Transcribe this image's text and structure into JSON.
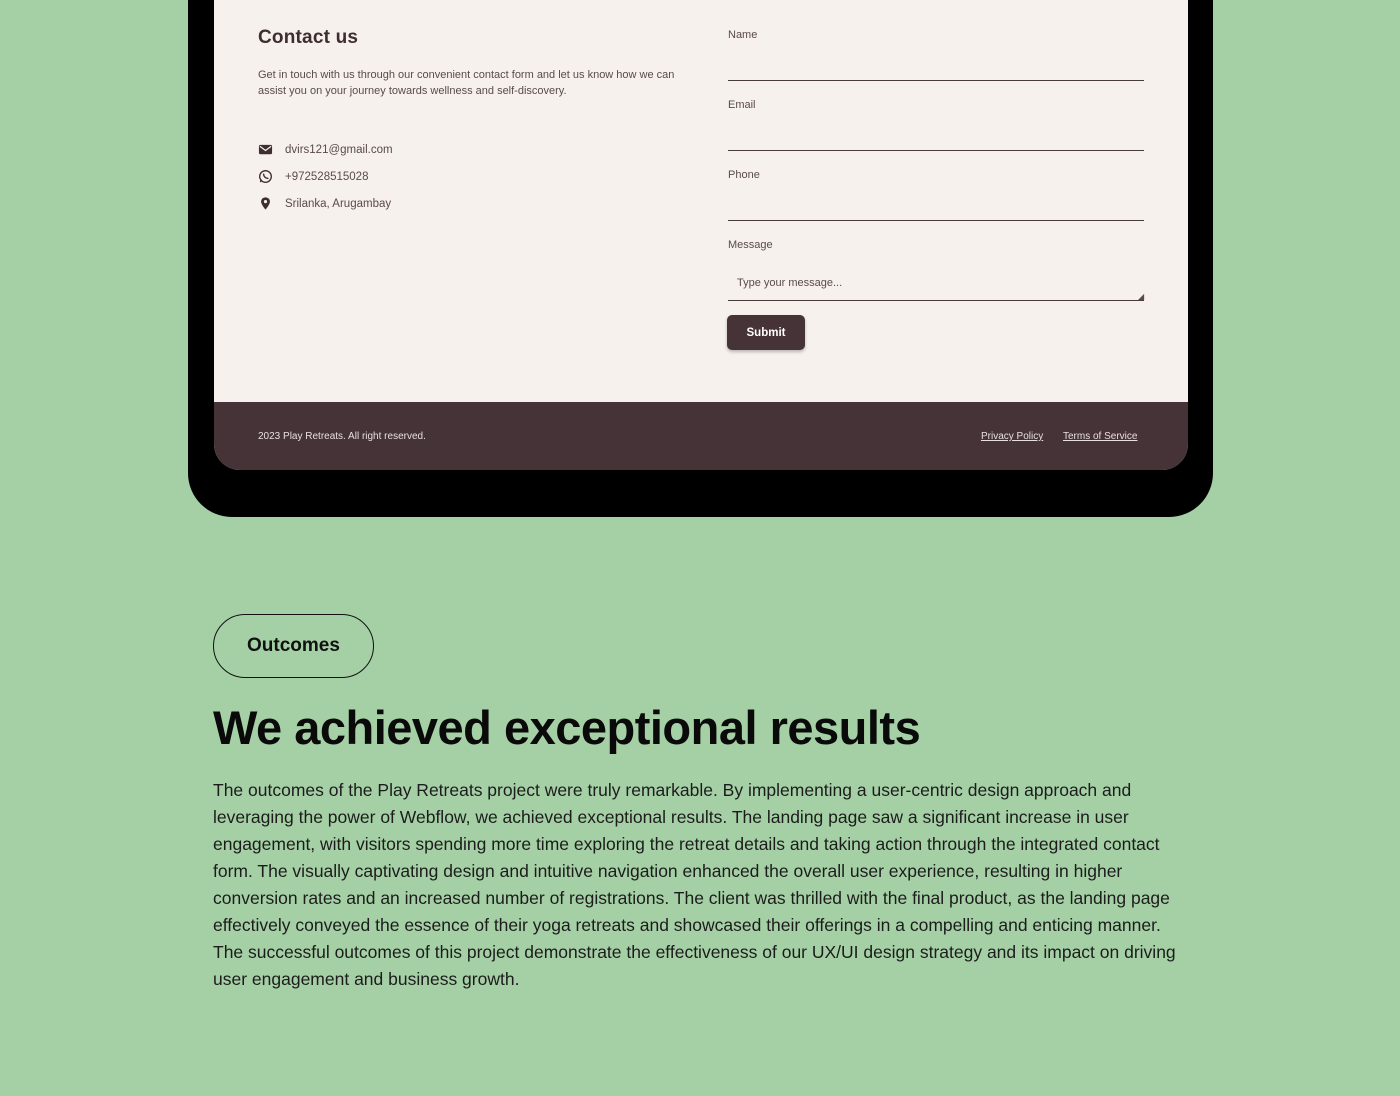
{
  "contact": {
    "title": "Contact us",
    "description": "Get in touch with us through our convenient contact form and let us know how we can assist you on your journey towards wellness and self-discovery.",
    "email": "dvirs121@gmail.com",
    "phone": "+972528515028",
    "location": "Srilanka, Arugambay",
    "icons": [
      "envelope-icon",
      "whatsapp-icon",
      "location-pin-icon"
    ]
  },
  "form": {
    "name_label": "Name",
    "email_label": "Email",
    "phone_label": "Phone",
    "message_label": "Message",
    "message_placeholder": "Type your message...",
    "submit_label": "Submit"
  },
  "footer": {
    "copyright": "2023 Play Retreats. All right reserved.",
    "privacy_label": "Privacy Policy",
    "terms_label": "Terms of Service"
  },
  "outcomes": {
    "badge": "Outcomes",
    "headline": "We achieved exceptional results",
    "body": "The outcomes of the Play Retreats project were truly remarkable. By implementing a user-centric design approach and leveraging the power of Webflow, we achieved exceptional results. The landing page saw a significant increase in user engagement, with visitors spending more time exploring the retreat details and taking action through the integrated contact form. The visually captivating design and intuitive navigation enhanced the overall user experience, resulting in higher conversion rates and an increased number of registrations. The client was thrilled with the final product, as the landing page effectively conveyed the essence of their yoga retreats and showcased their offerings in a compelling and enticing manner. The successful outcomes of this project demonstrate the effectiveness of our UX/UI design strategy and its impact on driving user engagement and business growth."
  },
  "colors": {
    "background": "#a5d0a5",
    "screen": "#f6f1ec",
    "brand_dark": "#453337",
    "device_frame": "#000000"
  }
}
